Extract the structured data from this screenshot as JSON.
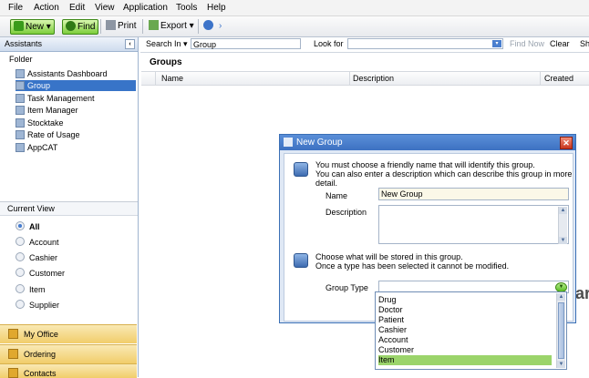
{
  "menu": [
    "File",
    "Action",
    "Edit",
    "View",
    "Application",
    "Tools",
    "Help"
  ],
  "toolbar": {
    "new_label": "New",
    "find_label": "Find",
    "print_label": "Print",
    "export_label": "Export"
  },
  "assistants": {
    "header": "Assistants",
    "folder_label": "Folder",
    "items": [
      {
        "label": "Assistants Dashboard",
        "icon": "dashboard-icon"
      },
      {
        "label": "Group",
        "icon": "group-icon",
        "selected": true
      },
      {
        "label": "Task Management",
        "icon": "task-icon"
      },
      {
        "label": "Item Manager",
        "icon": "item-manager-icon"
      },
      {
        "label": "Stocktake",
        "icon": "stocktake-icon"
      },
      {
        "label": "Rate of Usage",
        "icon": "rate-icon"
      },
      {
        "label": "AppCAT",
        "icon": "appcat-icon"
      }
    ]
  },
  "current_view": {
    "header": "Current View",
    "options": [
      "All",
      "Account",
      "Cashier",
      "Customer",
      "Item",
      "Supplier"
    ],
    "selected": "All"
  },
  "nav_buttons": [
    "My Office",
    "Ordering",
    "Contacts"
  ],
  "search": {
    "search_in_label": "Search In",
    "search_in_value": "Group",
    "look_for_label": "Look for",
    "look_for_value": "",
    "find_now_label": "Find Now",
    "clear_label": "Clear",
    "overflow_label": "Sh"
  },
  "groups": {
    "title": "Groups",
    "columns": [
      "Name",
      "Description",
      "Created"
    ]
  },
  "dialog": {
    "title": "New Group",
    "intro_line1": "You must choose a friendly name that will identify this group.",
    "intro_line2": "You can also enter a description which can describe this group in more detail.",
    "name_label": "Name",
    "name_value": "New Group",
    "description_label": "Description",
    "description_value": "",
    "type_line1": "Choose what will be stored in this group.",
    "type_line2": "Once a type has been selected it cannot be modified.",
    "group_type_label": "Group Type",
    "group_type_value": ""
  },
  "dropdown_options": [
    "Drug",
    "Doctor",
    "Patient",
    "Cashier",
    "Account",
    "Customer",
    "Item"
  ],
  "dropdown_highlighted": "Item",
  "background_text": "ar",
  "colors": {
    "accent": "#3874c8",
    "dialog_title": "#3d71c2",
    "highlight": "#9bd46b"
  }
}
